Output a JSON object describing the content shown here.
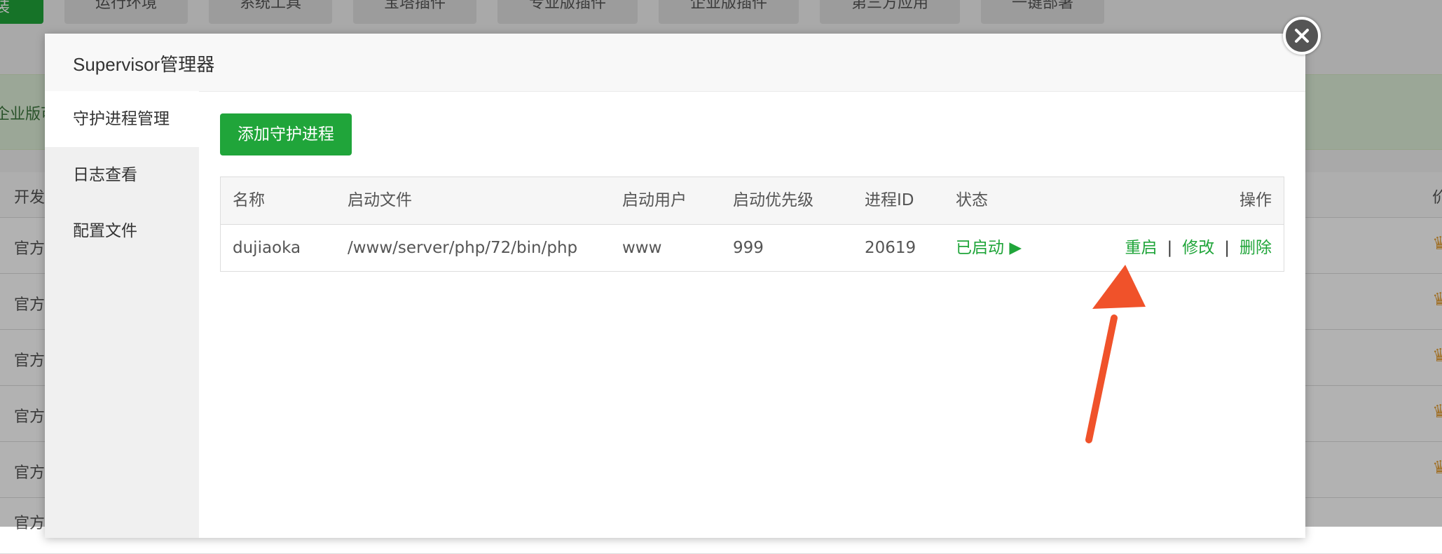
{
  "background": {
    "left_tab": "装",
    "top_tabs": [
      "运行环境",
      "系统工具",
      "宝塔插件",
      "专业版插件",
      "企业版插件",
      "第三方应用",
      "一键部署"
    ],
    "banner_text": "企业版可",
    "table_header": "开发",
    "row_label": "官方",
    "row_icon": "crown-icon",
    "right_header_fragment": "价"
  },
  "modal": {
    "title": "Supervisor管理器",
    "close_icon": "close-icon",
    "sidebar": [
      {
        "label": "守护进程管理",
        "active": true
      },
      {
        "label": "日志查看",
        "active": false
      },
      {
        "label": "配置文件",
        "active": false
      }
    ],
    "add_button": "添加守护进程",
    "table": {
      "headers": {
        "name": "名称",
        "file": "启动文件",
        "user": "启动用户",
        "priority": "启动优先级",
        "pid": "进程ID",
        "status": "状态",
        "ops": "操作"
      },
      "rows": [
        {
          "name": "dujiaoka",
          "file": "/www/server/php/72/bin/php",
          "user": "www",
          "priority": "999",
          "pid": "20619",
          "status": "已启动",
          "status_icon": "play-icon",
          "restart": "重启",
          "edit": "修改",
          "delete": "删除",
          "separator": "|"
        }
      ]
    }
  },
  "annotation": {
    "arrow_color": "#f0522a"
  },
  "colors": {
    "accent": "#20a53a",
    "overlay": "rgba(0,0,0,0.30)"
  }
}
